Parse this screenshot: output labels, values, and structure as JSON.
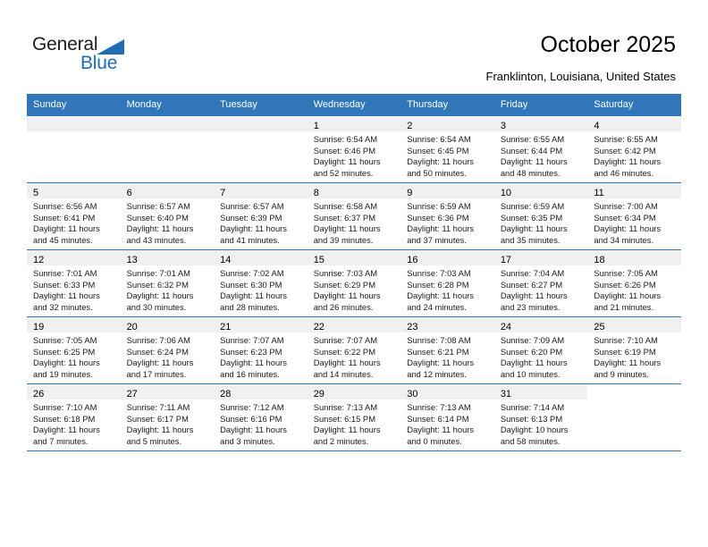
{
  "logo": {
    "word1": "General",
    "word2": "Blue",
    "triangle_color": "#1f6db5"
  },
  "header": {
    "title": "October 2025",
    "subtitle": "Franklinton, Louisiana, United States"
  },
  "theme": {
    "header_row_bg": "#3076b8",
    "day_band_bg": "#f0f0f0",
    "grid_line": "#3076b8"
  },
  "calendar": {
    "weekday_headers": [
      "Sunday",
      "Monday",
      "Tuesday",
      "Wednesday",
      "Thursday",
      "Friday",
      "Saturday"
    ],
    "weeks": [
      [
        {
          "day": "",
          "lines": []
        },
        {
          "day": "",
          "lines": []
        },
        {
          "day": "",
          "lines": []
        },
        {
          "day": "1",
          "lines": [
            "Sunrise: 6:54 AM",
            "Sunset: 6:46 PM",
            "Daylight: 11 hours",
            "and 52 minutes."
          ]
        },
        {
          "day": "2",
          "lines": [
            "Sunrise: 6:54 AM",
            "Sunset: 6:45 PM",
            "Daylight: 11 hours",
            "and 50 minutes."
          ]
        },
        {
          "day": "3",
          "lines": [
            "Sunrise: 6:55 AM",
            "Sunset: 6:44 PM",
            "Daylight: 11 hours",
            "and 48 minutes."
          ]
        },
        {
          "day": "4",
          "lines": [
            "Sunrise: 6:55 AM",
            "Sunset: 6:42 PM",
            "Daylight: 11 hours",
            "and 46 minutes."
          ]
        }
      ],
      [
        {
          "day": "5",
          "lines": [
            "Sunrise: 6:56 AM",
            "Sunset: 6:41 PM",
            "Daylight: 11 hours",
            "and 45 minutes."
          ]
        },
        {
          "day": "6",
          "lines": [
            "Sunrise: 6:57 AM",
            "Sunset: 6:40 PM",
            "Daylight: 11 hours",
            "and 43 minutes."
          ]
        },
        {
          "day": "7",
          "lines": [
            "Sunrise: 6:57 AM",
            "Sunset: 6:39 PM",
            "Daylight: 11 hours",
            "and 41 minutes."
          ]
        },
        {
          "day": "8",
          "lines": [
            "Sunrise: 6:58 AM",
            "Sunset: 6:37 PM",
            "Daylight: 11 hours",
            "and 39 minutes."
          ]
        },
        {
          "day": "9",
          "lines": [
            "Sunrise: 6:59 AM",
            "Sunset: 6:36 PM",
            "Daylight: 11 hours",
            "and 37 minutes."
          ]
        },
        {
          "day": "10",
          "lines": [
            "Sunrise: 6:59 AM",
            "Sunset: 6:35 PM",
            "Daylight: 11 hours",
            "and 35 minutes."
          ]
        },
        {
          "day": "11",
          "lines": [
            "Sunrise: 7:00 AM",
            "Sunset: 6:34 PM",
            "Daylight: 11 hours",
            "and 34 minutes."
          ]
        }
      ],
      [
        {
          "day": "12",
          "lines": [
            "Sunrise: 7:01 AM",
            "Sunset: 6:33 PM",
            "Daylight: 11 hours",
            "and 32 minutes."
          ]
        },
        {
          "day": "13",
          "lines": [
            "Sunrise: 7:01 AM",
            "Sunset: 6:32 PM",
            "Daylight: 11 hours",
            "and 30 minutes."
          ]
        },
        {
          "day": "14",
          "lines": [
            "Sunrise: 7:02 AM",
            "Sunset: 6:30 PM",
            "Daylight: 11 hours",
            "and 28 minutes."
          ]
        },
        {
          "day": "15",
          "lines": [
            "Sunrise: 7:03 AM",
            "Sunset: 6:29 PM",
            "Daylight: 11 hours",
            "and 26 minutes."
          ]
        },
        {
          "day": "16",
          "lines": [
            "Sunrise: 7:03 AM",
            "Sunset: 6:28 PM",
            "Daylight: 11 hours",
            "and 24 minutes."
          ]
        },
        {
          "day": "17",
          "lines": [
            "Sunrise: 7:04 AM",
            "Sunset: 6:27 PM",
            "Daylight: 11 hours",
            "and 23 minutes."
          ]
        },
        {
          "day": "18",
          "lines": [
            "Sunrise: 7:05 AM",
            "Sunset: 6:26 PM",
            "Daylight: 11 hours",
            "and 21 minutes."
          ]
        }
      ],
      [
        {
          "day": "19",
          "lines": [
            "Sunrise: 7:05 AM",
            "Sunset: 6:25 PM",
            "Daylight: 11 hours",
            "and 19 minutes."
          ]
        },
        {
          "day": "20",
          "lines": [
            "Sunrise: 7:06 AM",
            "Sunset: 6:24 PM",
            "Daylight: 11 hours",
            "and 17 minutes."
          ]
        },
        {
          "day": "21",
          "lines": [
            "Sunrise: 7:07 AM",
            "Sunset: 6:23 PM",
            "Daylight: 11 hours",
            "and 16 minutes."
          ]
        },
        {
          "day": "22",
          "lines": [
            "Sunrise: 7:07 AM",
            "Sunset: 6:22 PM",
            "Daylight: 11 hours",
            "and 14 minutes."
          ]
        },
        {
          "day": "23",
          "lines": [
            "Sunrise: 7:08 AM",
            "Sunset: 6:21 PM",
            "Daylight: 11 hours",
            "and 12 minutes."
          ]
        },
        {
          "day": "24",
          "lines": [
            "Sunrise: 7:09 AM",
            "Sunset: 6:20 PM",
            "Daylight: 11 hours",
            "and 10 minutes."
          ]
        },
        {
          "day": "25",
          "lines": [
            "Sunrise: 7:10 AM",
            "Sunset: 6:19 PM",
            "Daylight: 11 hours",
            "and 9 minutes."
          ]
        }
      ],
      [
        {
          "day": "26",
          "lines": [
            "Sunrise: 7:10 AM",
            "Sunset: 6:18 PM",
            "Daylight: 11 hours",
            "and 7 minutes."
          ]
        },
        {
          "day": "27",
          "lines": [
            "Sunrise: 7:11 AM",
            "Sunset: 6:17 PM",
            "Daylight: 11 hours",
            "and 5 minutes."
          ]
        },
        {
          "day": "28",
          "lines": [
            "Sunrise: 7:12 AM",
            "Sunset: 6:16 PM",
            "Daylight: 11 hours",
            "and 3 minutes."
          ]
        },
        {
          "day": "29",
          "lines": [
            "Sunrise: 7:13 AM",
            "Sunset: 6:15 PM",
            "Daylight: 11 hours",
            "and 2 minutes."
          ]
        },
        {
          "day": "30",
          "lines": [
            "Sunrise: 7:13 AM",
            "Sunset: 6:14 PM",
            "Daylight: 11 hours",
            "and 0 minutes."
          ]
        },
        {
          "day": "31",
          "lines": [
            "Sunrise: 7:14 AM",
            "Sunset: 6:13 PM",
            "Daylight: 10 hours",
            "and 58 minutes."
          ]
        },
        {
          "day": "",
          "lines": []
        }
      ]
    ]
  }
}
